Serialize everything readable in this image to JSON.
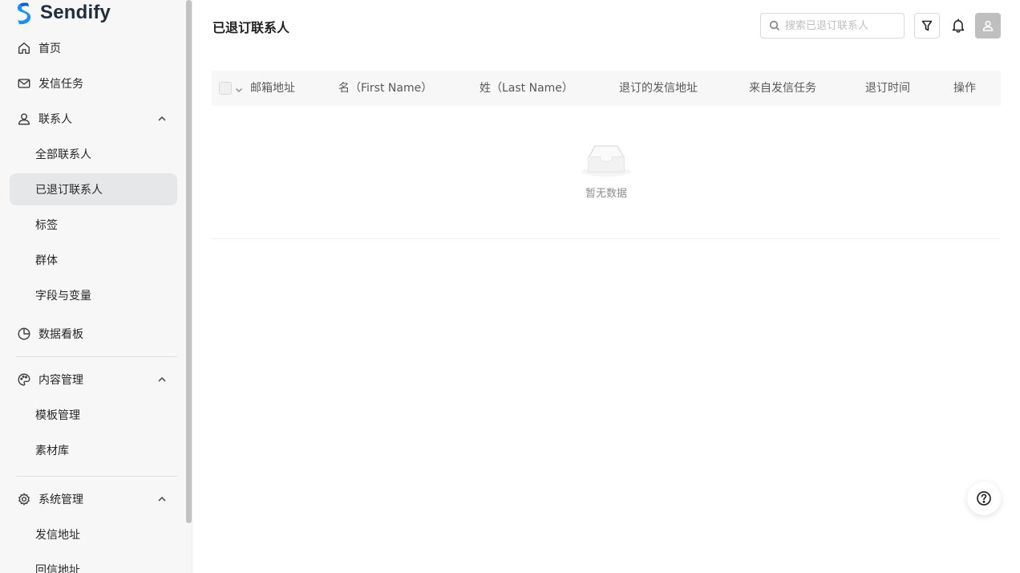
{
  "brand": {
    "name": "Sendify",
    "accent": "#1890ff"
  },
  "sidebar": {
    "items": [
      {
        "label": "首页",
        "icon": "home-icon"
      },
      {
        "label": "发信任务",
        "icon": "mail-icon"
      },
      {
        "label": "联系人",
        "icon": "user-icon",
        "expanded": true
      },
      {
        "label": "全部联系人"
      },
      {
        "label": "已退订联系人",
        "active": true
      },
      {
        "label": "标签"
      },
      {
        "label": "群体"
      },
      {
        "label": "字段与变量"
      },
      {
        "label": "数据看板",
        "icon": "pie-chart-icon"
      },
      {
        "label": "内容管理",
        "icon": "palette-icon",
        "expanded": true
      },
      {
        "label": "模板管理"
      },
      {
        "label": "素材库"
      },
      {
        "label": "系统管理",
        "icon": "gear-icon",
        "expanded": true
      },
      {
        "label": "发信地址"
      },
      {
        "label": "回信地址"
      }
    ]
  },
  "header": {
    "title": "已退订联系人",
    "search_placeholder": "搜索已退订联系人"
  },
  "table": {
    "columns": [
      "邮箱地址",
      "名（First Name）",
      "姓（Last Name）",
      "退订的发信地址",
      "来自发信任务",
      "退订时间",
      "操作"
    ],
    "rows": [],
    "empty_text": "暂无数据"
  }
}
